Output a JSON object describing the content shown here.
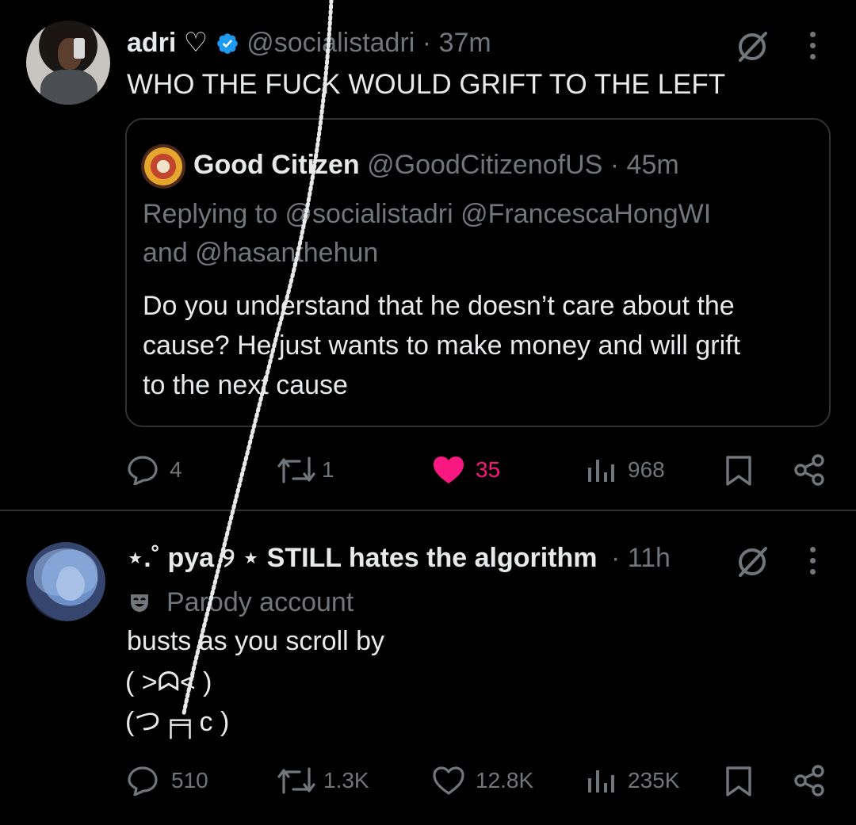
{
  "post1": {
    "author_name": "adri ♡",
    "handle": "@socialistadri",
    "time": "· 37m",
    "text": "WHO THE FUCK WOULD GRIFT TO THE LEFT",
    "quote": {
      "author_name": "Good Citizen",
      "handle": "@GoodCitizenofUS",
      "time": "· 45m",
      "replying_line1": "Replying to @socialistadri @FrancescaHongWI",
      "replying_line2": "and @hasanthehun",
      "text_line1": "Do you understand that he doesn’t care about the",
      "text_line2": "cause? He just wants to make money and will grift",
      "text_line3": "to the next cause"
    },
    "actions": {
      "replies": "4",
      "reposts": "1",
      "likes": "35",
      "views": "968"
    }
  },
  "post2": {
    "author_name": "⋆.˚ pya ୨ ⋆ STILL hates the algorithm",
    "time": "· 11h",
    "parody_label": "Parody account",
    "text_line1": "busts as you scroll by",
    "text_line2": "( ˃ᗣ˂ )",
    "text_line3": "(つ╒╕c )",
    "actions": {
      "replies": "510",
      "reposts": "1.3K",
      "likes": "12.8K",
      "views": "235K"
    }
  },
  "colors": {
    "background": "#000000",
    "text": "#e7e9ea",
    "muted": "#71767b",
    "like_active": "#f91880",
    "verified_blue": "#1d9bf0",
    "border": "#2f3336"
  }
}
